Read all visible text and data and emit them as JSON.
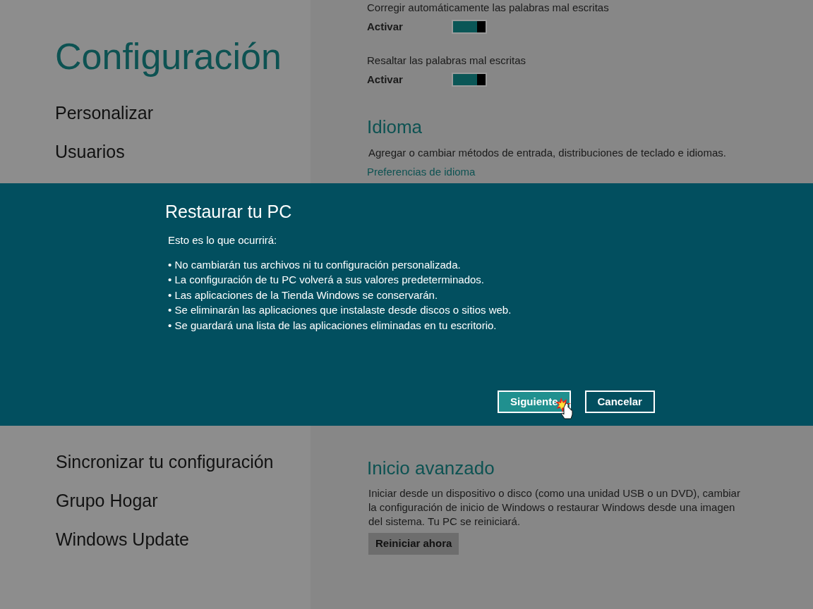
{
  "sidebar": {
    "title": "Configuración",
    "items_top": [
      {
        "label": "Personalizar"
      },
      {
        "label": "Usuarios"
      }
    ],
    "items_bottom": [
      {
        "label": "Sincronizar tu configuración"
      },
      {
        "label": "Grupo Hogar"
      },
      {
        "label": "Windows Update"
      }
    ]
  },
  "content": {
    "toggles": [
      {
        "label": "Corregir automáticamente las palabras mal escritas",
        "state_label": "Activar",
        "on": true
      },
      {
        "label": "Resaltar las palabras mal escritas",
        "state_label": "Activar",
        "on": true
      }
    ],
    "language": {
      "heading": "Idioma",
      "description": "Agregar o cambiar métodos de entrada, distribuciones de teclado e idiomas.",
      "link": "Preferencias de idioma"
    },
    "advanced": {
      "heading": "Inicio avanzado",
      "description": "Iniciar desde un dispositivo o disco (como una unidad USB o un DVD), cambiar la configuración de inicio de Windows o restaurar Windows desde una imagen del sistema. Tu PC se reiniciará.",
      "button": "Reiniciar ahora"
    }
  },
  "dialog": {
    "title": "Restaurar tu PC",
    "intro": "Esto es lo que ocurrirá:",
    "bullets": [
      "• No cambiarán tus archivos ni tu configuración personalizada.",
      "• La configuración de tu PC volverá a sus valores predeterminados.",
      "• Las aplicaciones de la Tienda Windows se conservarán.",
      "• Se eliminarán las aplicaciones que instalaste desde discos o sitios web.",
      "• Se guardará una lista de las aplicaciones eliminadas en tu escritorio."
    ],
    "buttons": [
      {
        "label": "Siguiente",
        "kind": "primary"
      },
      {
        "label": "Cancelar",
        "kind": "secondary"
      }
    ]
  }
}
